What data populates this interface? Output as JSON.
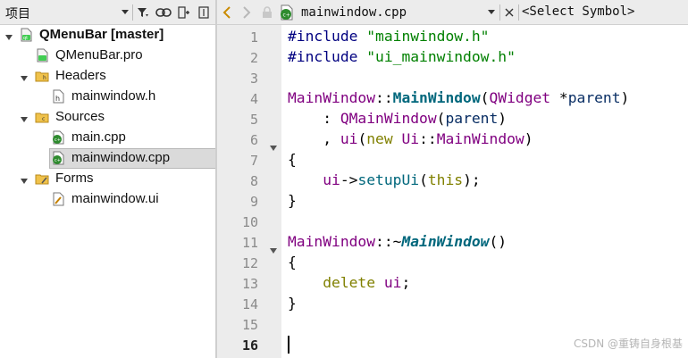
{
  "project_pane": {
    "title": "项目",
    "toolbar_icons": [
      "chevron-down-icon",
      "filter-icon",
      "link-icon",
      "split-icon",
      "close-pane-icon"
    ]
  },
  "tree": {
    "project": "QMenuBar [master]",
    "pro_file": "QMenuBar.pro",
    "headers_folder": "Headers",
    "header_file": "mainwindow.h",
    "sources_folder": "Sources",
    "source_file_1": "main.cpp",
    "source_file_2": "mainwindow.cpp",
    "forms_folder": "Forms",
    "form_file": "mainwindow.ui"
  },
  "editor": {
    "file_name": "mainwindow.cpp",
    "symbol_selector": "<Select Symbol>",
    "current_line": 16,
    "line_numbers": [
      "1",
      "2",
      "3",
      "4",
      "5",
      "6",
      "7",
      "8",
      "9",
      "10",
      "11",
      "12",
      "13",
      "14",
      "15",
      "16"
    ],
    "code": {
      "l1_directive": "#include",
      "l1_string": "\"mainwindow.h\"",
      "l2_directive": "#include",
      "l2_string": "\"ui_mainwindow.h\"",
      "l4_class": "MainWindow",
      "l4_sep": "::",
      "l4_func": "MainWindow",
      "l4_open": "(",
      "l4_type": "QWidget",
      "l4_star": " *",
      "l4_param": "parent",
      "l4_close": ")",
      "l5_colon": "    : ",
      "l5_base": "QMainWindow",
      "l5_open": "(",
      "l5_param": "parent",
      "l5_close": ")",
      "l6_comma": "    , ",
      "l6_member": "ui",
      "l6_open": "(",
      "l6_new": "new",
      "l6_ns": "Ui",
      "l6_sep": "::",
      "l6_type": "MainWindow",
      "l6_close": ")",
      "l7": "{",
      "l8_indent": "    ",
      "l8_member": "ui",
      "l8_arrow": "->",
      "l8_func": "setupUi",
      "l8_open": "(",
      "l8_this": "this",
      "l8_close": ");",
      "l9": "}",
      "l11_class": "MainWindow",
      "l11_sep": "::~",
      "l11_func": "MainWindow",
      "l11_parens": "()",
      "l12": "{",
      "l13_indent": "    ",
      "l13_delete": "delete",
      "l13_space": " ",
      "l13_member": "ui",
      "l13_semi": ";",
      "l14": "}"
    }
  },
  "watermark": "CSDN @重铸自身根基"
}
